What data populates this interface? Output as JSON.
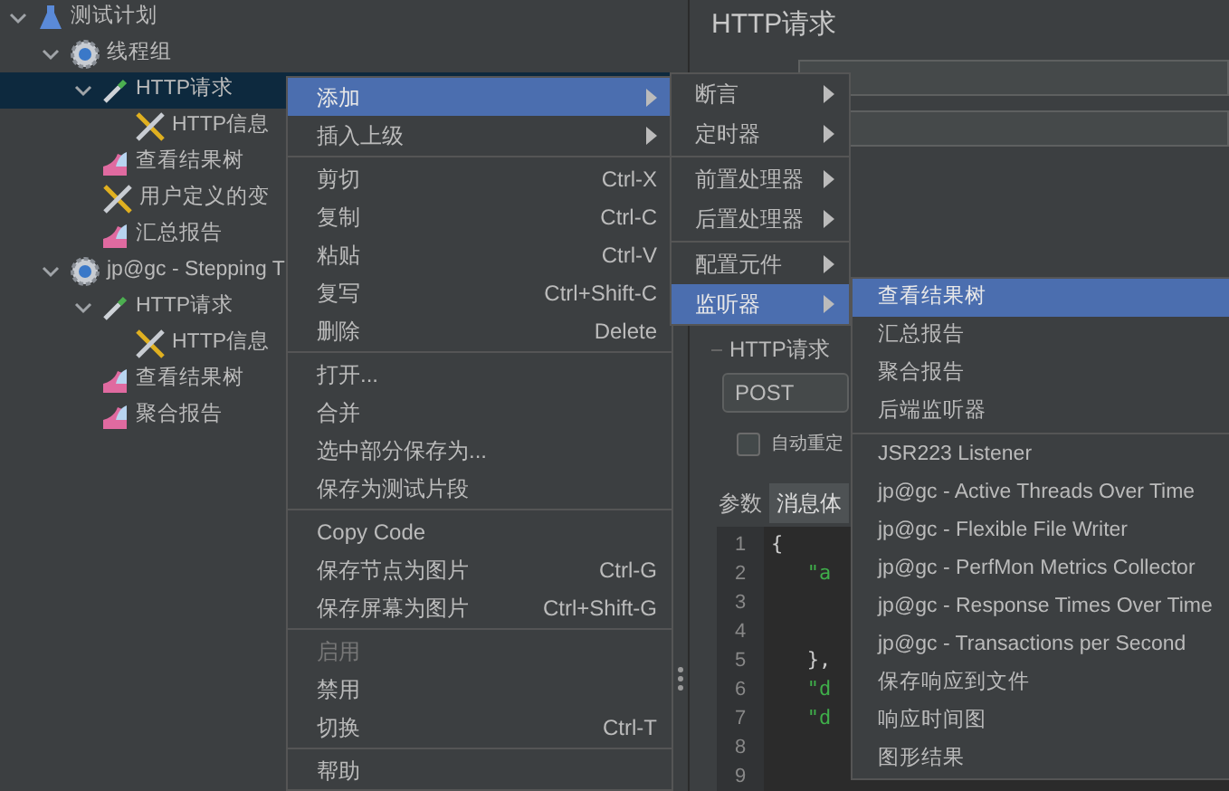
{
  "tree": [
    {
      "label": "测试计划",
      "kind": "plan",
      "expanded": true,
      "selected": false,
      "children": [
        {
          "label": "线程组",
          "kind": "thread-group",
          "expanded": true,
          "selected": false,
          "children": [
            {
              "label": "HTTP请求",
              "kind": "sampler",
              "expanded": true,
              "selected": true,
              "children": [
                {
                  "label": "HTTP信息",
                  "kind": "config",
                  "selected": false
                }
              ]
            },
            {
              "label": "查看结果树",
              "kind": "listener",
              "selected": false
            },
            {
              "label": "用户定义的变",
              "kind": "config",
              "selected": false
            },
            {
              "label": "汇总报告",
              "kind": "listener",
              "selected": false
            }
          ]
        },
        {
          "label": "jp@gc - Stepping T",
          "kind": "thread-group",
          "expanded": true,
          "selected": false,
          "children": [
            {
              "label": "HTTP请求",
              "kind": "sampler",
              "expanded": true,
              "selected": false,
              "children": [
                {
                  "label": "HTTP信息",
                  "kind": "config",
                  "selected": false
                }
              ]
            },
            {
              "label": "查看结果树",
              "kind": "listener",
              "selected": false
            },
            {
              "label": "聚合报告",
              "kind": "listener",
              "selected": false
            }
          ]
        }
      ]
    }
  ],
  "panel": {
    "title": "HTTP请求",
    "group_label": "HTTP请求",
    "method": "POST",
    "redirect_checkbox": {
      "label": "自动重定",
      "checked": false
    },
    "tabs": [
      {
        "label": "参数",
        "selected": false
      },
      {
        "label": "消息体",
        "selected": true
      }
    ],
    "editor_lines": [
      {
        "number": "1",
        "text": "{",
        "kind": "punct"
      },
      {
        "number": "2",
        "text": "   \"a",
        "kind": "string"
      },
      {
        "number": "3"
      },
      {
        "number": "4"
      },
      {
        "number": "5",
        "text": "   },",
        "kind": "punct"
      },
      {
        "number": "6",
        "text": "   \"d",
        "kind": "string"
      },
      {
        "number": "7",
        "text": "   \"d",
        "kind": "string"
      },
      {
        "number": "8"
      },
      {
        "number": "9"
      }
    ]
  },
  "context_menu": [
    {
      "kind": "item",
      "label": "添加",
      "submenu": true,
      "selected": true,
      "disabled": false
    },
    {
      "kind": "item",
      "label": "插入上级",
      "submenu": true,
      "selected": false,
      "disabled": false
    },
    {
      "kind": "separator"
    },
    {
      "kind": "item",
      "label": "剪切",
      "shortcut": "Ctrl-X",
      "submenu": false,
      "selected": false,
      "disabled": false
    },
    {
      "kind": "item",
      "label": "复制",
      "shortcut": "Ctrl-C",
      "submenu": false,
      "selected": false,
      "disabled": false
    },
    {
      "kind": "item",
      "label": "粘贴",
      "shortcut": "Ctrl-V",
      "submenu": false,
      "selected": false,
      "disabled": false
    },
    {
      "kind": "item",
      "label": "复写",
      "shortcut": "Ctrl+Shift-C",
      "submenu": false,
      "selected": false,
      "disabled": false
    },
    {
      "kind": "item",
      "label": "删除",
      "shortcut": "Delete",
      "submenu": false,
      "selected": false,
      "disabled": false
    },
    {
      "kind": "separator"
    },
    {
      "kind": "item",
      "label": "打开...",
      "submenu": false,
      "selected": false,
      "disabled": false
    },
    {
      "kind": "item",
      "label": "合并",
      "submenu": false,
      "selected": false,
      "disabled": false
    },
    {
      "kind": "item",
      "label": "选中部分保存为...",
      "submenu": false,
      "selected": false,
      "disabled": false
    },
    {
      "kind": "item",
      "label": "保存为测试片段",
      "submenu": false,
      "selected": false,
      "disabled": false
    },
    {
      "kind": "separator"
    },
    {
      "kind": "item",
      "label": "Copy Code",
      "submenu": false,
      "selected": false,
      "disabled": false
    },
    {
      "kind": "item",
      "label": "保存节点为图片",
      "shortcut": "Ctrl-G",
      "submenu": false,
      "selected": false,
      "disabled": false
    },
    {
      "kind": "item",
      "label": "保存屏幕为图片",
      "shortcut": "Ctrl+Shift-G",
      "submenu": false,
      "selected": false,
      "disabled": false
    },
    {
      "kind": "separator"
    },
    {
      "kind": "item",
      "label": "启用",
      "submenu": false,
      "selected": false,
      "disabled": true
    },
    {
      "kind": "item",
      "label": "禁用",
      "submenu": false,
      "selected": false,
      "disabled": false
    },
    {
      "kind": "item",
      "label": "切换",
      "shortcut": "Ctrl-T",
      "submenu": false,
      "selected": false,
      "disabled": false
    },
    {
      "kind": "separator"
    },
    {
      "kind": "item",
      "label": "帮助",
      "submenu": false,
      "selected": false,
      "disabled": false
    }
  ],
  "add_submenu": [
    {
      "kind": "item",
      "label": "断言",
      "submenu": true,
      "selected": false
    },
    {
      "kind": "item",
      "label": "定时器",
      "submenu": true,
      "selected": false
    },
    {
      "kind": "separator"
    },
    {
      "kind": "item",
      "label": "前置处理器",
      "submenu": true,
      "selected": false
    },
    {
      "kind": "item",
      "label": "后置处理器",
      "submenu": true,
      "selected": false
    },
    {
      "kind": "separator"
    },
    {
      "kind": "item",
      "label": "配置元件",
      "submenu": true,
      "selected": false
    },
    {
      "kind": "item",
      "label": "监听器",
      "submenu": true,
      "selected": true
    }
  ],
  "listener_submenu": [
    {
      "kind": "item",
      "label": "查看结果树",
      "selected": true
    },
    {
      "kind": "item",
      "label": "汇总报告",
      "selected": false
    },
    {
      "kind": "item",
      "label": "聚合报告",
      "selected": false
    },
    {
      "kind": "item",
      "label": "后端监听器",
      "selected": false
    },
    {
      "kind": "separator"
    },
    {
      "kind": "item",
      "label": "JSR223 Listener",
      "selected": false
    },
    {
      "kind": "item",
      "label": "jp@gc - Active Threads Over Time",
      "selected": false
    },
    {
      "kind": "item",
      "label": "jp@gc - Flexible File Writer",
      "selected": false
    },
    {
      "kind": "item",
      "label": "jp@gc - PerfMon Metrics Collector",
      "selected": false
    },
    {
      "kind": "item",
      "label": "jp@gc - Response Times Over Time",
      "selected": false
    },
    {
      "kind": "item",
      "label": "jp@gc - Transactions per Second",
      "selected": false
    },
    {
      "kind": "item",
      "label": "保存响应到文件",
      "selected": false
    },
    {
      "kind": "item",
      "label": "响应时间图",
      "selected": false
    },
    {
      "kind": "item",
      "label": "图形结果",
      "selected": false
    }
  ]
}
